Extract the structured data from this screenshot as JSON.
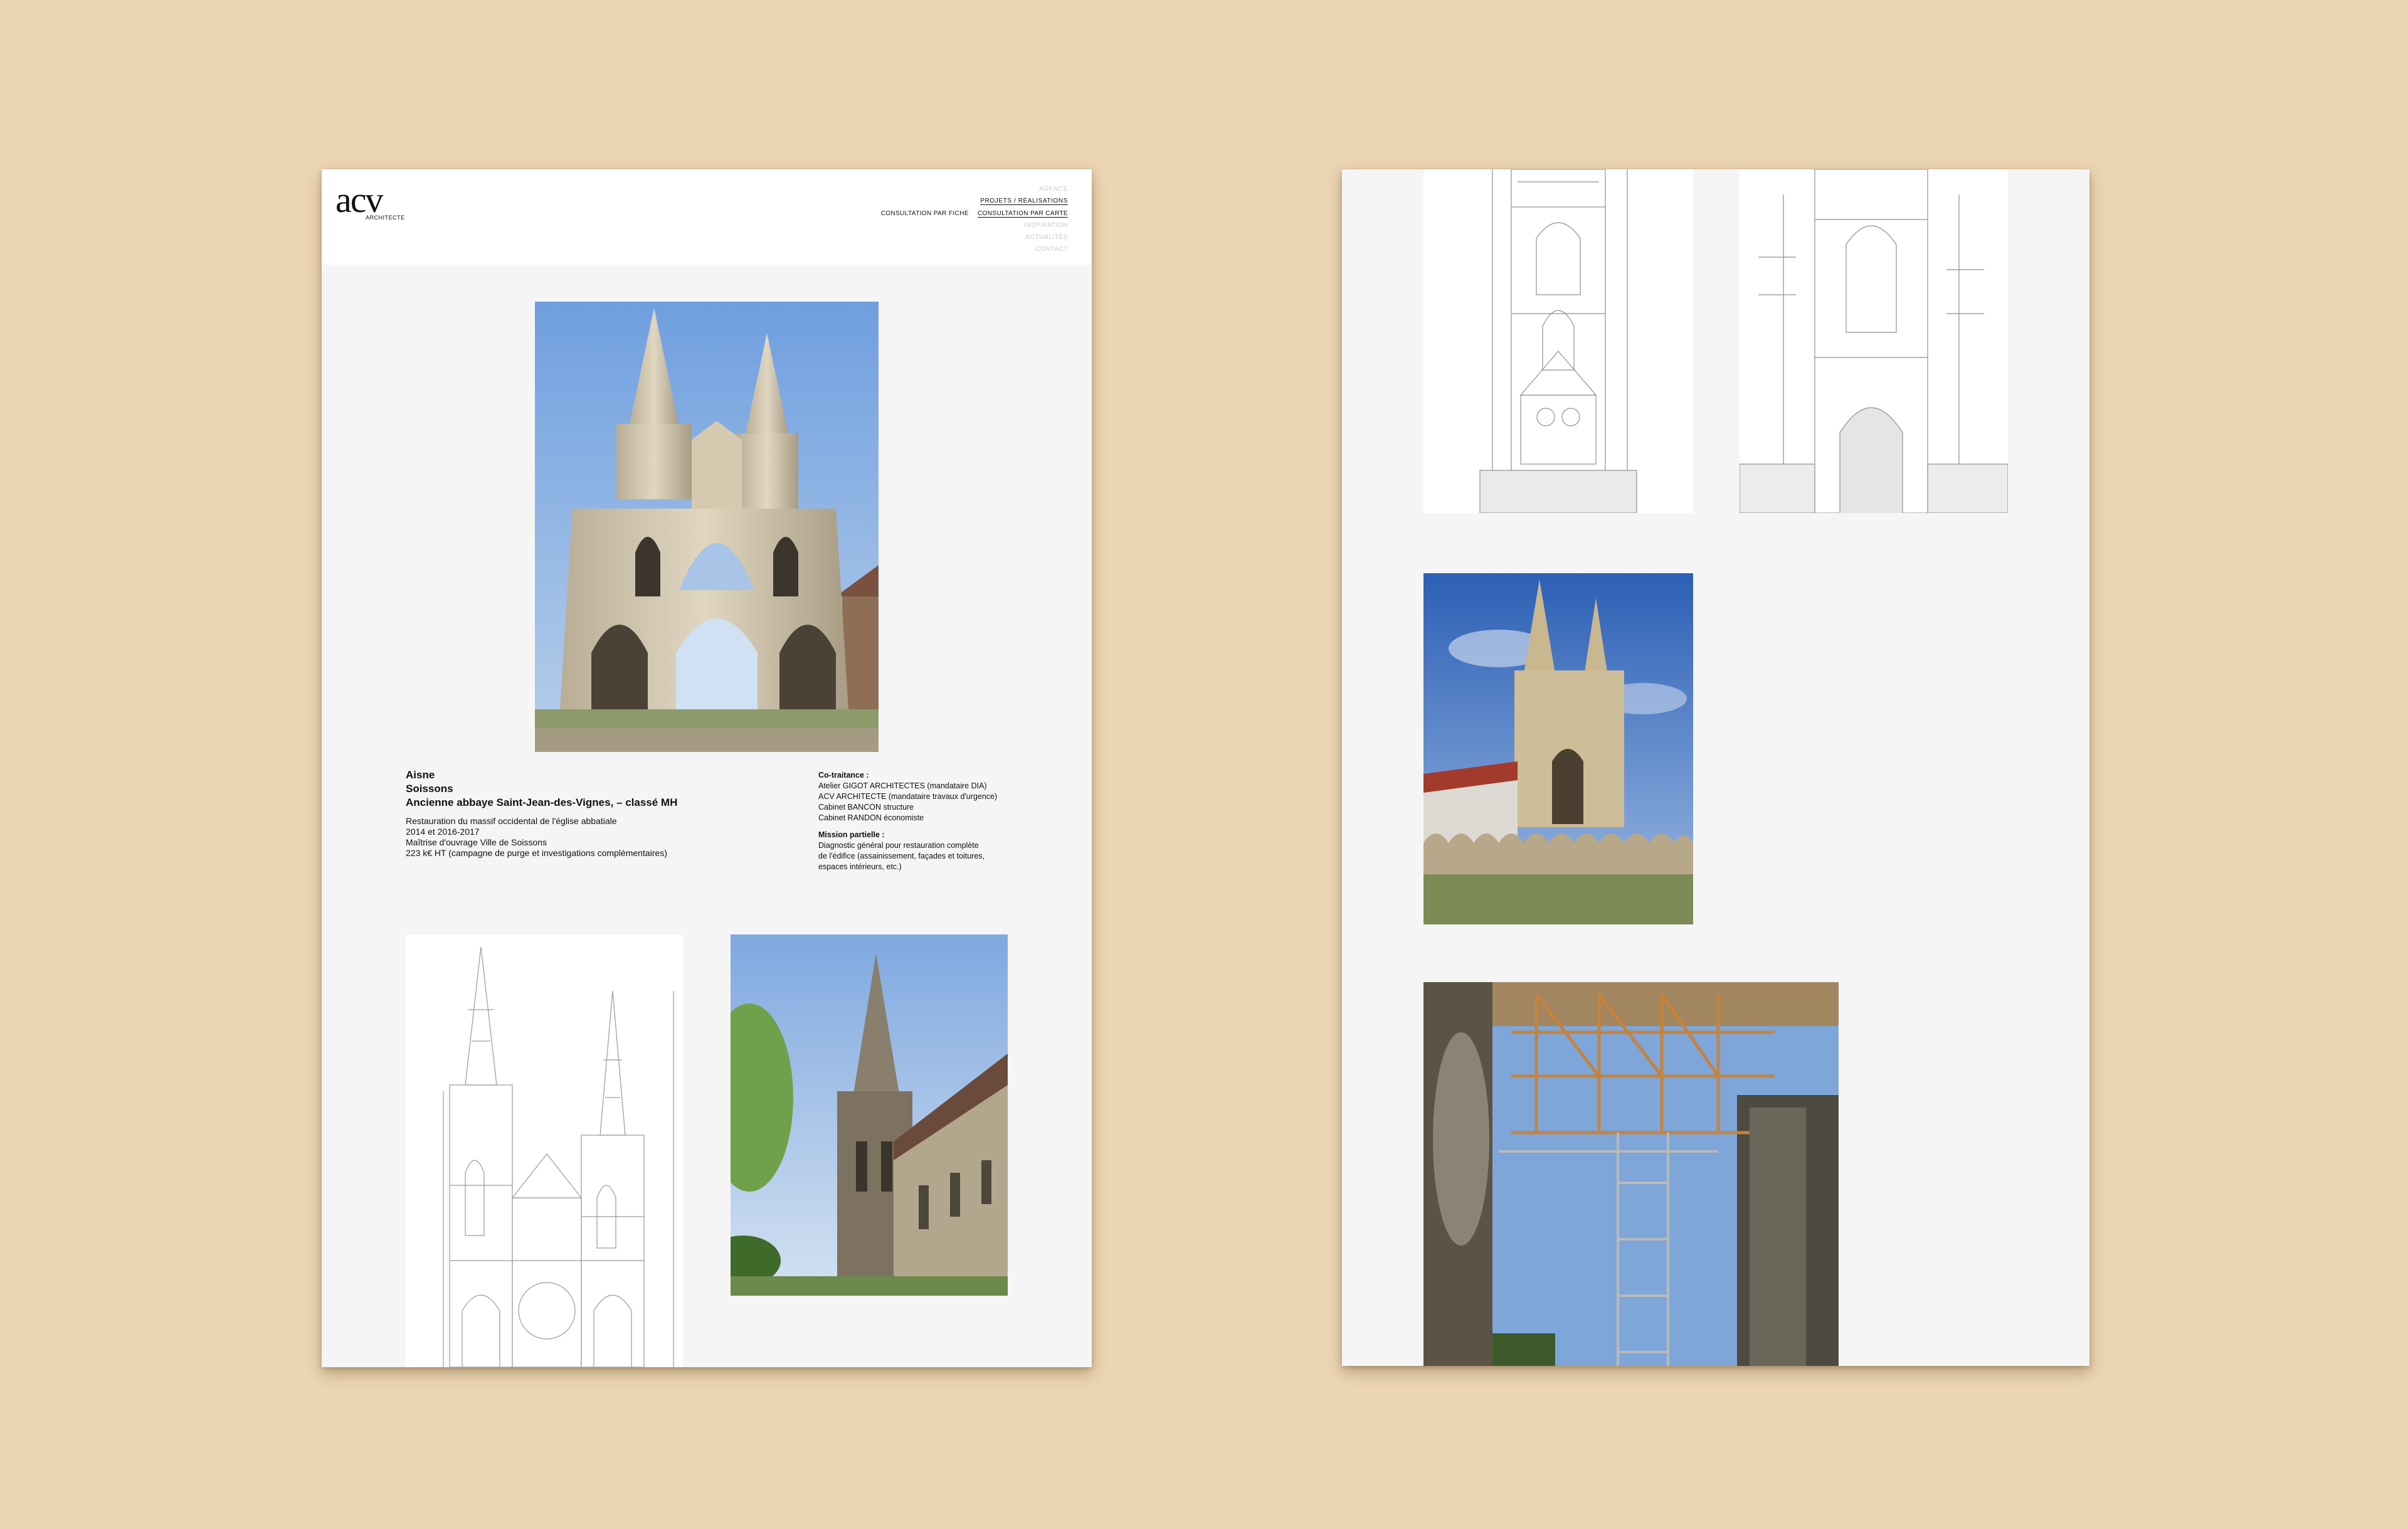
{
  "site": {
    "logo_text": "acv",
    "logo_subtext": "ARCHITECTE"
  },
  "nav": {
    "items": [
      {
        "label": "AGENCE",
        "active": false
      },
      {
        "label": "PROJETS / RÉALISATIONS",
        "active": true
      }
    ],
    "sub_items": [
      "CONSULTATION PAR FICHE",
      "CONSULTATION PAR CARTE"
    ],
    "more_items": [
      "INSPIRATION",
      "ACTUALITÉS",
      "CONTACT"
    ]
  },
  "project": {
    "department": "Aisne",
    "city": "Soissons",
    "name": "Ancienne abbaye Saint-Jean-des-Vignes, – classé MH",
    "description_lines": [
      "Restauration du massif occidental de l'église abbatiale",
      "2014 et 2016-2017",
      "Maîtrise d'ouvrage Ville de Soissons",
      "223 k€ HT (campagne de purge et investigations complémentaires)"
    ],
    "cotraitance_title": "Co-traitance :",
    "cotraitance_lines": [
      "Atelier GIGOT ARCHITECTES (mandataire DIA)",
      "ACV ARCHITECTE (mandataire travaux d'urgence)",
      "Cabinet BANCON structure",
      "Cabinet RANDON économiste"
    ],
    "mission_title": "Mission partielle :",
    "mission_lines": [
      "Diagnostic général pour restauration complète",
      "de l'édifice (assainissement, façades et toitures,",
      "espaces intérieurs, etc.)"
    ]
  },
  "colors": {
    "background": "#ecd5b3",
    "page": "#f5f5f5",
    "header": "#ffffff",
    "text": "#111111",
    "nav_inactive": "#c8c8c8",
    "sky": "#8fb3e0",
    "stone": "#d9cdb3"
  },
  "images": [
    {
      "name": "facade-photo",
      "subject": "west facade of abbey with two spires"
    },
    {
      "name": "facade-elevation-drawing",
      "subject": "architectural elevation drawing"
    },
    {
      "name": "tower-side-photo",
      "subject": "tower and nave side view"
    },
    {
      "name": "tower-section-drawing-1",
      "subject": "tower elevation drawing"
    },
    {
      "name": "tower-section-drawing-2",
      "subject": "tower section drawing"
    },
    {
      "name": "abbey-cloister-photo",
      "subject": "abbey with cloister arcades"
    },
    {
      "name": "scaffolding-photo",
      "subject": "scaffolding under arch"
    }
  ]
}
